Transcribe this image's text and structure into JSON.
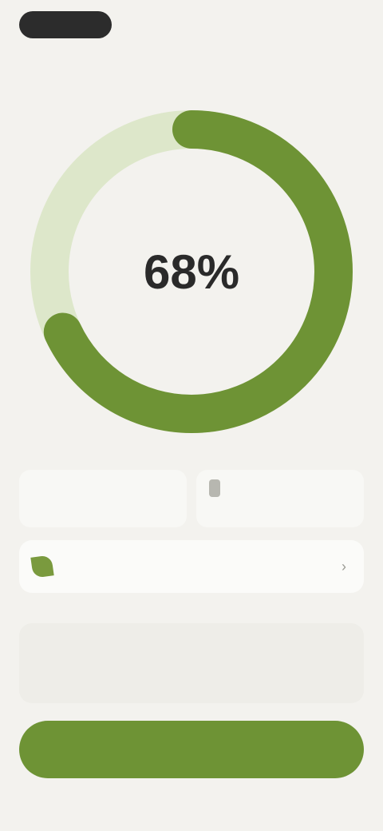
{
  "header": {
    "pill_label": "",
    "right_label": "",
    "tabs": [
      {
        "label": ""
      },
      {
        "label": ""
      }
    ]
  },
  "ring": {
    "value_text": "68%",
    "progress": 0.68,
    "colors": {
      "track": "#dde7ca",
      "fill": "#6e9335"
    }
  },
  "stats": [
    {
      "label": "",
      "value": ""
    },
    {
      "label": "",
      "value": ""
    }
  ],
  "selector": {
    "value": "",
    "icon": "leaf-icon"
  },
  "note": {
    "text": ""
  },
  "cta": {
    "label": ""
  },
  "colors": {
    "accent": "#6e9335",
    "background": "#f3f2ee",
    "dark_pill": "#2c2c2c"
  }
}
